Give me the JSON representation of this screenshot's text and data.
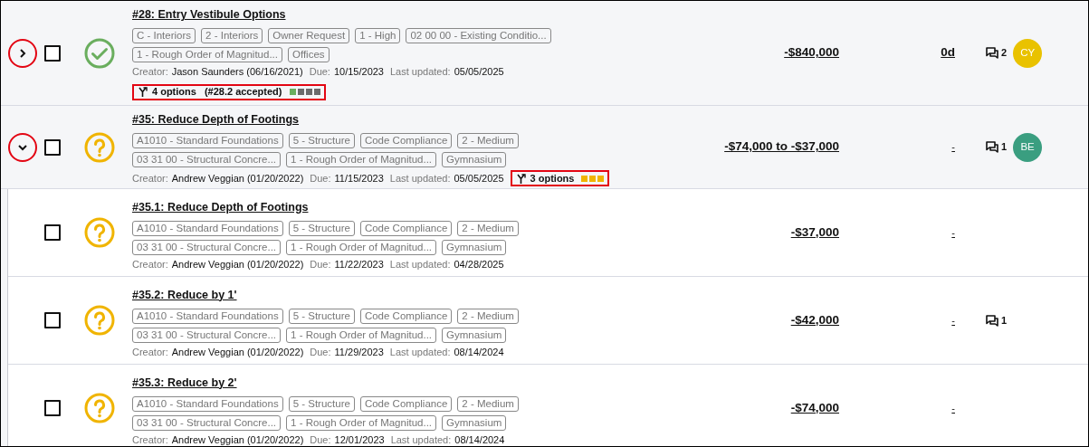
{
  "items": [
    {
      "expanded": false,
      "checked": false,
      "kind": "accepted",
      "title": "#28: Entry Vestibule Options",
      "tag_rows": [
        [
          "C - Interiors",
          "2 - Interiors",
          "Owner Request",
          "1 - High",
          "02 00 00 - Existing Conditio..."
        ],
        [
          "1 - Rough Order of Magnitud...",
          "Offices"
        ]
      ],
      "creator_label": "Creator:",
      "creator": "Jason Saunders (06/16/2021)",
      "due_label": "Due:",
      "due": "10/15/2023",
      "updated_label": "Last updated:",
      "updated": "05/05/2025",
      "options": {
        "inline": false,
        "label": "4 options",
        "accepted": "(#28.2 accepted)",
        "squares": [
          {
            "color": "#6aae5e"
          },
          {
            "color": "#6b6b6b"
          },
          {
            "color": "#6b6b6b"
          },
          {
            "color": "#6b6b6b"
          }
        ]
      },
      "amount": "-$840,000",
      "schedule": "0d",
      "comments": "2",
      "avatar": {
        "initials": "CY",
        "color": "#e9c200"
      }
    },
    {
      "expanded": true,
      "checked": false,
      "kind": "pending",
      "title": "#35: Reduce Depth of Footings",
      "tag_rows": [
        [
          "A1010 - Standard Foundations",
          "5 - Structure",
          "Code Compliance",
          "2 - Medium"
        ],
        [
          "03 31 00 - Structural Concre...",
          "1 - Rough Order of Magnitud...",
          "Gymnasium"
        ]
      ],
      "creator_label": "Creator:",
      "creator": "Andrew Veggian (01/20/2022)",
      "due_label": "Due:",
      "due": "11/15/2023",
      "updated_label": "Last updated:",
      "updated": "05/05/2025",
      "options": {
        "inline": true,
        "label": "3 options",
        "squares": [
          {
            "color": "#f0b400"
          },
          {
            "color": "#f0b400"
          },
          {
            "color": "#f0b400"
          }
        ]
      },
      "amount": "-$74,000 to -$37,000",
      "schedule": "-",
      "comments": "1",
      "avatar": {
        "initials": "BE",
        "color": "#3a9e80"
      },
      "children": [
        {
          "checked": false,
          "kind": "pending",
          "title": "#35.1: Reduce Depth of Footings",
          "tag_rows": [
            [
              "A1010 - Standard Foundations",
              "5 - Structure",
              "Code Compliance",
              "2 - Medium"
            ],
            [
              "03 31 00 - Structural Concre...",
              "1 - Rough Order of Magnitud...",
              "Gymnasium"
            ]
          ],
          "creator_label": "Creator:",
          "creator": "Andrew Veggian (01/20/2022)",
          "due_label": "Due:",
          "due": "11/22/2023",
          "updated_label": "Last updated:",
          "updated": "04/28/2025",
          "amount": "-$37,000",
          "schedule": "-"
        },
        {
          "checked": false,
          "kind": "pending",
          "title": "#35.2: Reduce by 1'",
          "tag_rows": [
            [
              "A1010 - Standard Foundations",
              "5 - Structure",
              "Code Compliance",
              "2 - Medium"
            ],
            [
              "03 31 00 - Structural Concre...",
              "1 - Rough Order of Magnitud...",
              "Gymnasium"
            ]
          ],
          "creator_label": "Creator:",
          "creator": "Andrew Veggian (01/20/2022)",
          "due_label": "Due:",
          "due": "11/29/2023",
          "updated_label": "Last updated:",
          "updated": "08/14/2024",
          "amount": "-$42,000",
          "schedule": "-",
          "comments": "1"
        },
        {
          "checked": false,
          "kind": "pending",
          "title": "#35.3: Reduce by 2'",
          "tag_rows": [
            [
              "A1010 - Standard Foundations",
              "5 - Structure",
              "Code Compliance",
              "2 - Medium"
            ],
            [
              "03 31 00 - Structural Concre...",
              "1 - Rough Order of Magnitud...",
              "Gymnasium"
            ]
          ],
          "creator_label": "Creator:",
          "creator": "Andrew Veggian (01/20/2022)",
          "due_label": "Due:",
          "due": "12/01/2023",
          "updated_label": "Last updated:",
          "updated": "08/14/2024",
          "amount": "-$74,000",
          "schedule": "-"
        }
      ]
    }
  ]
}
